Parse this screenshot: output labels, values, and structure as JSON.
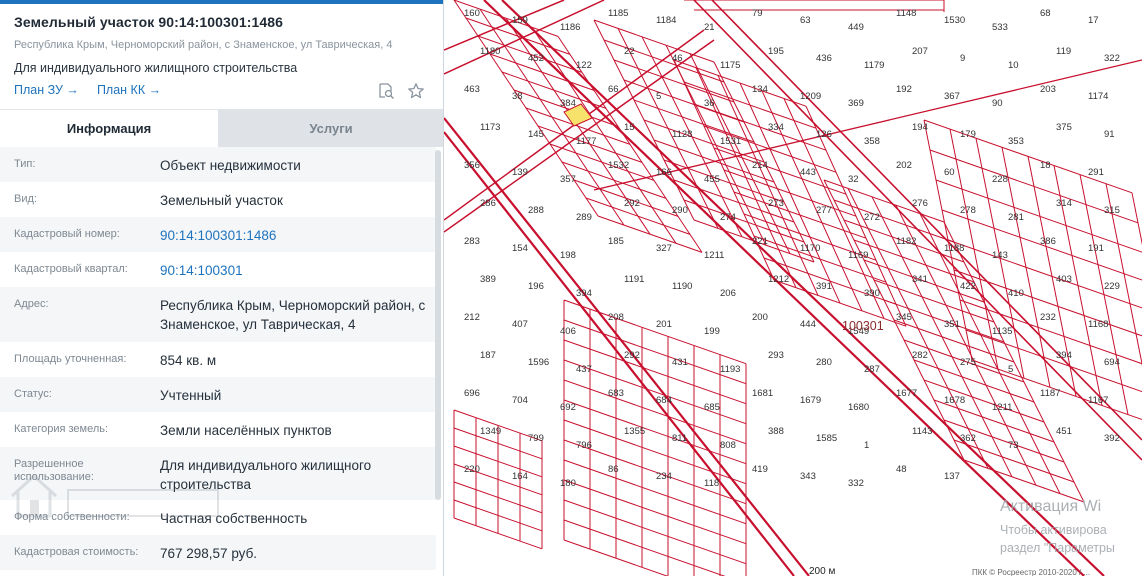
{
  "parcel": {
    "title": "Земельный участок 90:14:100301:1486",
    "address": "Республика Крым, Черноморский район, с Знаменское, ул Таврическая, 4",
    "purpose": "Для индивидуального жилищного строительства"
  },
  "links": {
    "plan_zu": "План ЗУ →",
    "plan_kk": "План КК →"
  },
  "tabs": {
    "info": "Информация",
    "services": "Услуги"
  },
  "rows": [
    {
      "label": "Тип:",
      "value": "Объект недвижимости"
    },
    {
      "label": "Вид:",
      "value": "Земельный участок"
    },
    {
      "label": "Кадастровый номер:",
      "value": "90:14:100301:1486"
    },
    {
      "label": "Кадастровый квартал:",
      "value": "90:14:100301"
    },
    {
      "label": "Адрес:",
      "value": "Республика Крым, Черноморский район, с Знаменское, ул Таврическая, 4"
    },
    {
      "label": "Площадь уточненная:",
      "value": "854 кв. м"
    },
    {
      "label": "Статус:",
      "value": "Учтенный"
    },
    {
      "label": "Категория земель:",
      "value": "Земли населённых пунктов"
    },
    {
      "label": "Разрешенное использование:",
      "value": "Для индивидуального жилищного строительства"
    },
    {
      "label": "Форма собственности:",
      "value": "Частная собственность"
    },
    {
      "label": "Кадастровая стоимость:",
      "value": "767 298,57 руб."
    }
  ],
  "map": {
    "quarter_label": "100301",
    "scale": "200 м",
    "colors": {
      "border": "#c8102e",
      "highlight": "#f7e36b"
    },
    "parcels": [
      "160",
      "159",
      "1186",
      "1185",
      "1184",
      "21",
      "79",
      "63",
      "449",
      "1148",
      "1530",
      "533",
      "68",
      "17",
      "1180",
      "452",
      "122",
      "22",
      "46",
      "1175",
      "195",
      "436",
      "1179",
      "207",
      "9",
      "10",
      "119",
      "322",
      "463",
      "38",
      "384",
      "66",
      "5",
      "36",
      "134",
      "1209",
      "369",
      "192",
      "367",
      "90",
      "203",
      "1174",
      "1173",
      "145",
      "1177",
      "15",
      "1128",
      "1531",
      "334",
      "126",
      "358",
      "194",
      "179",
      "353",
      "375",
      "91",
      "356",
      "139",
      "357",
      "1532",
      "166",
      "455",
      "214",
      "443",
      "32",
      "202",
      "60",
      "228",
      "18",
      "291",
      "286",
      "288",
      "289",
      "292",
      "290",
      "274",
      "273",
      "277",
      "272",
      "276",
      "278",
      "281",
      "314",
      "315",
      "283",
      "154",
      "198",
      "185",
      "327",
      "1211",
      "221",
      "1170",
      "1169",
      "1182",
      "1188",
      "143",
      "386",
      "191",
      "389",
      "196",
      "394",
      "1191",
      "1190",
      "206",
      "1212",
      "391",
      "390",
      "341",
      "422",
      "410",
      "403",
      "229",
      "212",
      "407",
      "406",
      "208",
      "201",
      "199",
      "200",
      "444",
      "1549",
      "345",
      "351",
      "1135",
      "232",
      "1168",
      "187",
      "1596",
      "437",
      "292",
      "431",
      "1193",
      "293",
      "280",
      "287",
      "282",
      "275",
      "5",
      "394",
      "694",
      "696",
      "704",
      "692",
      "683",
      "684",
      "685",
      "1681",
      "1679",
      "1680",
      "1677",
      "1678",
      "1211",
      "1187",
      "1167",
      "1349",
      "799",
      "796",
      "1355",
      "811",
      "808",
      "388",
      "1585",
      "1",
      "1143",
      "362",
      "73",
      "451",
      "392",
      "220",
      "164",
      "180",
      "86",
      "234",
      "118",
      "419",
      "343",
      "332",
      "48",
      "137"
    ],
    "watermark_title": "Активация Wi",
    "watermark_lines": [
      "Чтобы активирова",
      "раздел \"Параметры"
    ],
    "copyright": "ПКК © Росреестр 2010-2020 / ..."
  }
}
